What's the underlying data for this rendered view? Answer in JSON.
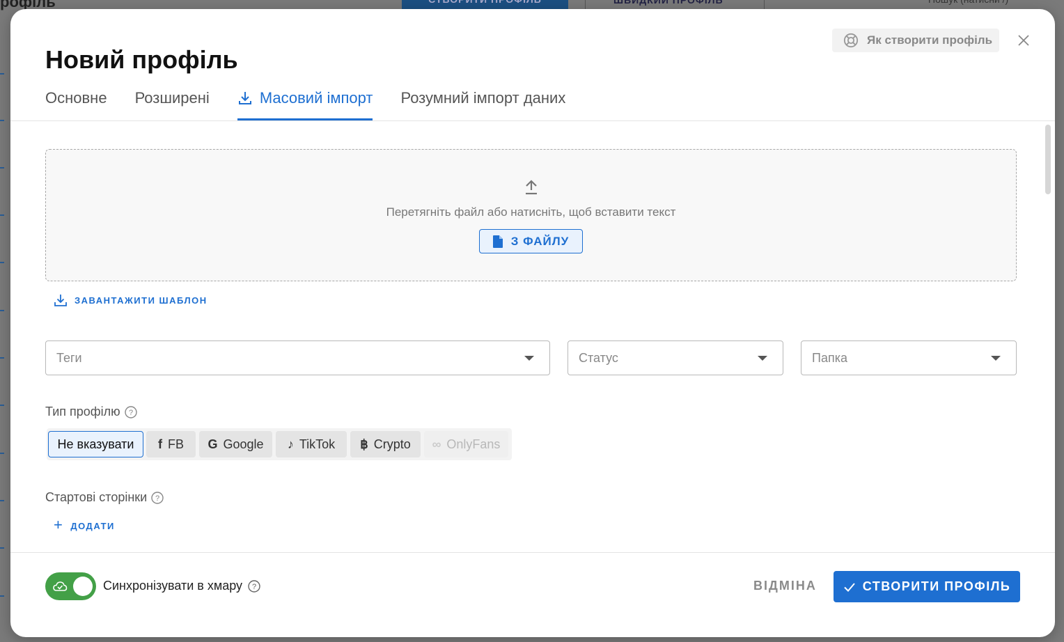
{
  "background": {
    "title": "рофіль",
    "create_button": "СТВОРИТИ ПРОФІЛЬ",
    "quick_profile_button": "ШВИДКИЙ ПРОФІЛЬ",
    "search_placeholder": "Пошук (натисни /)"
  },
  "modal": {
    "title": "Новий профіль",
    "help_button": "Як створити профіль",
    "tabs": [
      {
        "label": "Основне",
        "active": false
      },
      {
        "label": "Розширені",
        "active": false
      },
      {
        "label": "Масовий імпорт",
        "active": true
      },
      {
        "label": "Розумний імпорт даних",
        "active": false
      }
    ],
    "dropzone": {
      "hint": "Перетягніть файл або натисніть, щоб вставити текст",
      "file_button": "З ФАЙЛУ"
    },
    "download_template": "ЗАВАНТАЖИТИ ШАБЛОН",
    "selects": {
      "tags": "Теги",
      "status": "Статус",
      "folder": "Папка"
    },
    "profile_type": {
      "label": "Тип профілю",
      "options": [
        {
          "label": "Не вказувати",
          "icon": "none"
        },
        {
          "label": "FB",
          "icon": "facebook-icon"
        },
        {
          "label": "Google",
          "icon": "google-icon"
        },
        {
          "label": "TikTok",
          "icon": "tiktok-icon"
        },
        {
          "label": "Crypto",
          "icon": "bitcoin-icon"
        },
        {
          "label": "OnlyFans",
          "icon": "onlyfans-icon"
        }
      ],
      "selected": "Не вказувати"
    },
    "start_pages": {
      "label": "Стартові сторінки",
      "add_button": "ДОДАТИ"
    },
    "footer": {
      "sync_label": "Синхронізувати в хмару",
      "sync_enabled": true,
      "cancel_button": "ВІДМІНА",
      "create_button": "СТВОРИТИ ПРОФІЛЬ"
    }
  },
  "colors": {
    "accent": "#1e6fd1",
    "toggle_on": "#43a047"
  }
}
